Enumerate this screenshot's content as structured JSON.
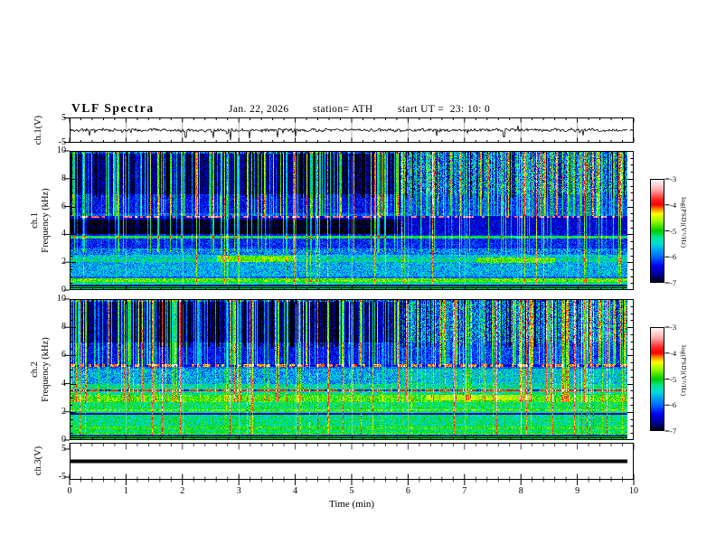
{
  "header": {
    "title": "VLF Spectra",
    "date": "Jan. 22, 2026",
    "station": "station= ATH",
    "start_ut": "start UT =  23: 10: 0"
  },
  "x_axis": {
    "label": "Time (min)",
    "min": 0,
    "max": 10,
    "tick_labels": [
      0,
      1,
      2,
      3,
      4,
      5,
      6,
      7,
      8,
      9,
      10
    ],
    "minor_step_min": 0.2
  },
  "panels": {
    "ch1_wave": {
      "ylabel": "ch.1(V)",
      "yticks": [
        5,
        -5
      ],
      "yrange": [
        -5,
        5
      ]
    },
    "ch1_spec": {
      "ylabel_ch": "ch.1",
      "ylabel_freq": "Frequency (kHz)",
      "yticks": [
        10,
        8,
        6,
        4,
        2,
        0
      ],
      "yrange_khz": [
        0,
        10
      ]
    },
    "ch2_spec": {
      "ylabel_ch": "ch.2",
      "ylabel_freq": "Frequency (kHz)",
      "yticks": [
        10,
        8,
        6,
        4,
        2,
        0
      ],
      "yrange_khz": [
        0,
        10
      ]
    },
    "ch3_wave": {
      "ylabel": "ch.3(V)",
      "yticks": [
        5,
        -5
      ],
      "yrange": [
        -5,
        5
      ]
    }
  },
  "colorbar": {
    "label": "log(PSD)(V²/Hz)",
    "ticks": [
      -3,
      -4,
      -5,
      -6,
      -7
    ],
    "range": [
      -7,
      -3
    ],
    "stops": [
      {
        "v": -7.0,
        "c": "#000000"
      },
      {
        "v": -6.7,
        "c": "#000090"
      },
      {
        "v": -6.35,
        "c": "#0000f0"
      },
      {
        "v": -6.0,
        "c": "#0068ff"
      },
      {
        "v": -5.5,
        "c": "#00dcdc"
      },
      {
        "v": -5.25,
        "c": "#00e890"
      },
      {
        "v": -5.0,
        "c": "#00cc00"
      },
      {
        "v": -4.6,
        "c": "#a0ff00"
      },
      {
        "v": -4.35,
        "c": "#ffff00"
      },
      {
        "v": -4.15,
        "c": "#ff8000"
      },
      {
        "v": -4.0,
        "c": "#ff0000"
      },
      {
        "v": -3.8,
        "c": "#ff2020"
      },
      {
        "v": -3.4,
        "c": "#ffb0b0"
      },
      {
        "v": -3.0,
        "c": "#ffffff"
      }
    ]
  },
  "chart_data": [
    {
      "name": "ch1_waveform",
      "type": "line",
      "ylabel": "ch.1(V)",
      "x_range_min": [
        0,
        10
      ],
      "y_range_v": [
        -5,
        5
      ],
      "data_end_min": 9.88,
      "baseline_v": 0,
      "noise_amp_v": 0.9,
      "seed": 11,
      "spikes": [
        {
          "t": 0.35,
          "v": -2.3
        },
        {
          "t": 2.06,
          "v": -3.0
        },
        {
          "t": 2.55,
          "v": -3.2
        },
        {
          "t": 2.85,
          "v": -4.2
        },
        {
          "t": 3.19,
          "v": -3.4
        },
        {
          "t": 3.68,
          "v": -3.0
        },
        {
          "t": 4.0,
          "v": -2.6
        },
        {
          "t": 6.5,
          "v": -2.4
        },
        {
          "t": 7.7,
          "v": -2.8
        },
        {
          "t": 7.95,
          "v": 1.8
        },
        {
          "t": 9.1,
          "v": -2.2
        }
      ]
    },
    {
      "name": "ch1_spectrogram",
      "type": "heatmap",
      "ylabel": "ch.1 Frequency (kHz)",
      "x_range_min": [
        0,
        10
      ],
      "y_range_khz": [
        0,
        10
      ],
      "z_log_psd_range": [
        -7,
        -3
      ],
      "data_end_min": 9.88,
      "regime_change_min": 5.85,
      "dark_stripe_end_min": 5.8,
      "seed": 7,
      "bands": [
        {
          "f": [
            9.82,
            10.05
          ],
          "l": -6.1,
          "n": 0.6
        },
        {
          "f": [
            6.9,
            9.82
          ],
          "l": -6.78,
          "n": 0.3,
          "rl": -6.0,
          "rn": 0.75
        },
        {
          "f": [
            5.5,
            6.9
          ],
          "l": -6.35,
          "n": 0.35,
          "rl": -6.15,
          "rn": 0.4
        },
        {
          "f": [
            5.35,
            5.5
          ],
          "l": -6.05,
          "n": 0.3
        },
        {
          "f": [
            5.2,
            5.35
          ],
          "l": -3.6,
          "n": 0.3,
          "dash": 0.45
        },
        {
          "f": [
            5.05,
            5.2
          ],
          "l": -6.5,
          "n": 0.25
        },
        {
          "f": [
            4.0,
            5.05
          ],
          "l": -6.92,
          "n": 0.22,
          "rl": -6.45,
          "rn": 0.3,
          "hs": true
        },
        {
          "f": [
            3.9,
            4.0
          ],
          "l": -6.3,
          "n": 0.3
        },
        {
          "f": [
            3.68,
            3.9
          ],
          "l": -5.15,
          "n": 0.3
        },
        {
          "f": [
            3.0,
            3.68
          ],
          "l": -6.25,
          "n": 0.35
        },
        {
          "f": [
            2.55,
            3.0
          ],
          "l": -5.9,
          "n": 0.45
        },
        {
          "f": [
            2.3,
            2.55
          ],
          "l": -5.55,
          "n": 0.45
        },
        {
          "f": [
            2.0,
            2.3
          ],
          "l": -5.35,
          "n": 0.5
        },
        {
          "f": [
            1.0,
            2.0
          ],
          "l": -5.7,
          "n": 0.45
        },
        {
          "f": [
            0.85,
            1.0
          ],
          "l": -6.0,
          "n": 0.3
        },
        {
          "f": [
            0.6,
            0.85
          ],
          "l": -4.8,
          "n": 0.35
        },
        {
          "f": [
            0.42,
            0.6
          ],
          "l": -5.25,
          "n": 0.3
        },
        {
          "f": [
            0.3,
            0.42
          ],
          "l": -6.4,
          "n": 0.25
        },
        {
          "f": [
            0.24,
            0.3
          ],
          "l": -7,
          "n": 0.05
        },
        {
          "f": [
            0.18,
            0.24
          ],
          "l": -5.2,
          "n": 0.2
        },
        {
          "f": [
            0.12,
            0.18
          ],
          "l": -7,
          "n": 0.05
        },
        {
          "f": [
            0.07,
            0.12
          ],
          "l": -5.2,
          "n": 0.2
        },
        {
          "f": [
            0,
            0.07
          ],
          "l": -7,
          "n": 0.05
        }
      ],
      "patches": [
        {
          "f": [
            2.0,
            2.45
          ],
          "t": [
            2.6,
            4.0
          ],
          "l": -4.75,
          "n": 0.3
        },
        {
          "f": [
            1.95,
            2.35
          ],
          "t": [
            7.2,
            8.6
          ],
          "l": -4.8,
          "n": 0.3
        }
      ],
      "sferics": {
        "column_probability": 0.4,
        "strength_range": [
          0.35,
          2.3
        ],
        "dark_gap_probability": 0.12,
        "full_height_probability": 0.03
      }
    },
    {
      "name": "ch2_spectrogram",
      "type": "heatmap",
      "ylabel": "ch.2 Frequency (kHz)",
      "x_range_min": [
        0,
        10
      ],
      "y_range_khz": [
        0,
        10
      ],
      "z_log_psd_range": [
        -7,
        -3
      ],
      "data_end_min": 9.88,
      "regime_change_min": 5.85,
      "dark_stripe_end_min": 5.8,
      "seed": 13,
      "bands": [
        {
          "f": [
            9.82,
            10.05
          ],
          "l": -6.1,
          "n": 0.6
        },
        {
          "f": [
            6.9,
            9.82
          ],
          "l": -6.75,
          "n": 0.3,
          "rl": -5.95,
          "rn": 0.75
        },
        {
          "f": [
            5.4,
            6.9
          ],
          "l": -6.35,
          "n": 0.35,
          "rl": -6.15,
          "rn": 0.4
        },
        {
          "f": [
            5.2,
            5.4
          ],
          "l": -4.15,
          "n": 0.3,
          "dash": 0.5
        },
        {
          "f": [
            5.05,
            5.2
          ],
          "l": -6.0,
          "n": 0.3
        },
        {
          "f": [
            4.0,
            5.05
          ],
          "l": -5.75,
          "n": 0.5,
          "rl": -5.55,
          "rn": 0.5
        },
        {
          "f": [
            3.6,
            4.0
          ],
          "l": -5.35,
          "n": 0.4
        },
        {
          "f": [
            3.45,
            3.6
          ],
          "l": -3.95,
          "n": 0.25,
          "dash": 0.8
        },
        {
          "f": [
            3.2,
            3.45
          ],
          "l": -5.3,
          "n": 0.4
        },
        {
          "f": [
            2.7,
            3.2
          ],
          "l": -4.85,
          "n": 0.35
        },
        {
          "f": [
            2.2,
            2.7
          ],
          "l": -5.15,
          "n": 0.4
        },
        {
          "f": [
            2.05,
            2.2
          ],
          "l": -4.8,
          "n": 0.3
        },
        {
          "f": [
            1.95,
            2.05
          ],
          "l": -5.3,
          "n": 0.3
        },
        {
          "f": [
            1.8,
            1.95
          ],
          "l": -6.55,
          "n": 0.25
        },
        {
          "f": [
            0.95,
            1.8
          ],
          "l": -5.25,
          "n": 0.4
        },
        {
          "f": [
            0.75,
            0.95
          ],
          "l": -4.95,
          "n": 0.3
        },
        {
          "f": [
            0.5,
            0.75
          ],
          "l": -5.2,
          "n": 0.3
        },
        {
          "f": [
            0.38,
            0.5
          ],
          "l": -4.9,
          "n": 0.25
        },
        {
          "f": [
            0.3,
            0.38
          ],
          "l": -6.0,
          "n": 0.3
        },
        {
          "f": [
            0.24,
            0.3
          ],
          "l": -7,
          "n": 0.05
        },
        {
          "f": [
            0.18,
            0.24
          ],
          "l": -5.1,
          "n": 0.2
        },
        {
          "f": [
            0.12,
            0.18
          ],
          "l": -7,
          "n": 0.05
        },
        {
          "f": [
            0.07,
            0.12
          ],
          "l": -5.1,
          "n": 0.2
        },
        {
          "f": [
            0.035,
            0.07
          ],
          "l": -7,
          "n": 0.05
        },
        {
          "f": [
            0,
            0.035
          ],
          "l": -4.3,
          "n": 0.2
        }
      ],
      "patches": [
        {
          "f": [
            2.8,
            3.2
          ],
          "t": [
            6.3,
            8.2
          ],
          "l": -4.55,
          "n": 0.3
        }
      ],
      "sferics": {
        "column_probability": 0.4,
        "strength_range": [
          0.35,
          2.3
        ],
        "dark_gap_probability": 0.12,
        "full_height_probability": 0.03
      }
    },
    {
      "name": "ch3_waveform",
      "type": "line",
      "ylabel": "ch.3(V)",
      "x_range_min": [
        0,
        10
      ],
      "y_range_v": [
        -5,
        5
      ],
      "data_end_min": 9.88,
      "constant_v": 0,
      "line_thickness_px": 4
    }
  ]
}
